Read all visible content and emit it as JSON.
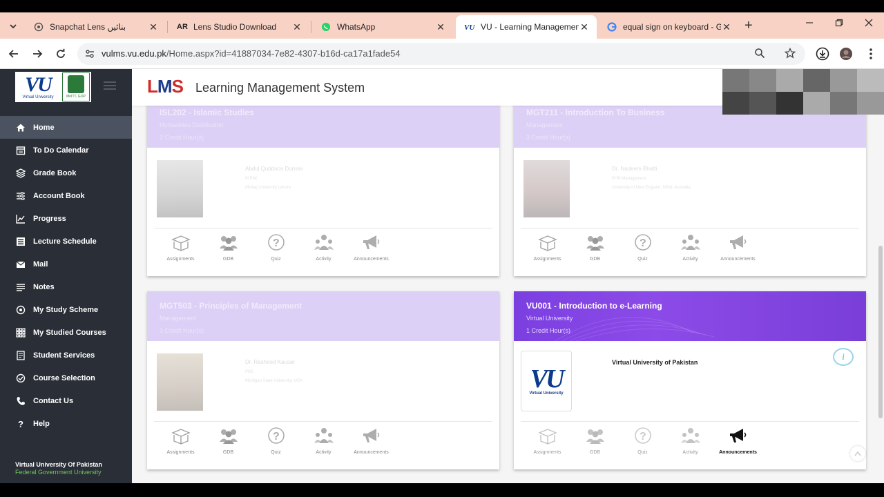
{
  "browser": {
    "tabs": [
      {
        "title": "Snapchat Lens بنائیں",
        "fav": "snap-icon"
      },
      {
        "title": "Lens Studio Download",
        "fav": "AR"
      },
      {
        "title": "WhatsApp",
        "fav": "whatsapp-icon"
      },
      {
        "title": "VU - Learning Management",
        "fav": "vu-icon",
        "active": true
      },
      {
        "title": "equal sign on keyboard - Go",
        "fav": "google-icon"
      }
    ],
    "url_host": "vulms.vu.edu.pk",
    "url_path": "/Home.aspx?id=41887034-7e82-4307-b16d-ca17a1fade54",
    "close_glyph": "✕",
    "new_tab_glyph": "+"
  },
  "sidebar": {
    "logo_text": "VU",
    "logo_sub": "Virtual University",
    "seal_cap": "MoITT, GOP",
    "items": [
      {
        "label": "Home",
        "icon": "home-icon"
      },
      {
        "label": "To Do Calendar",
        "icon": "calendar-icon"
      },
      {
        "label": "Grade Book",
        "icon": "grade-icon"
      },
      {
        "label": "Account Book",
        "icon": "account-icon"
      },
      {
        "label": "Progress",
        "icon": "progress-icon"
      },
      {
        "label": "Lecture Schedule",
        "icon": "schedule-icon"
      },
      {
        "label": "Mail",
        "icon": "mail-icon"
      },
      {
        "label": "Notes",
        "icon": "notes-icon"
      },
      {
        "label": "My Study Scheme",
        "icon": "scheme-icon"
      },
      {
        "label": "My Studied Courses",
        "icon": "courses-icon"
      },
      {
        "label": "Student Services",
        "icon": "services-icon"
      },
      {
        "label": "Course Selection",
        "icon": "selection-icon"
      },
      {
        "label": "Contact Us",
        "icon": "phone-icon"
      },
      {
        "label": "Help",
        "icon": "help-icon"
      }
    ],
    "footer_line1": "Virtual University Of Pakistan",
    "footer_line2": "Federal Government University"
  },
  "header": {
    "logo_l": "L",
    "logo_m": "M",
    "logo_s": "S",
    "title": "Learning Management System"
  },
  "actions": [
    "Assignments",
    "GDB",
    "Quiz",
    "Activity",
    "Announcements"
  ],
  "courses": [
    {
      "code": "ISL202 - Islamic Studies",
      "dept": "Humanities Distribution",
      "credits": "2 Credit Hour(s)",
      "instructor": "Abdul Quddoos Durrani",
      "qual": "M.Phil",
      "inst": "Minhaj University Lahore"
    },
    {
      "code": "MGT211 - Introduction To Business",
      "dept": "Management",
      "credits": "3 Credit Hour(s)",
      "instructor": "Dr. Nadeem Bhatti",
      "qual": "PHD Management",
      "inst": "University of New England, NSW, Australia"
    },
    {
      "code": "MGT503 - Principles of Management",
      "dept": "Management",
      "credits": "3 Credit Hour(s)",
      "instructor": "Dr. Rasheed Kausar",
      "qual": "PhD",
      "inst": "Michigan State University, USA"
    },
    {
      "code": "VU001 - Introduction to e-Learning",
      "dept": "Virtual University",
      "credits": "1 Credit Hour(s)",
      "instructor": "Virtual University of Pakistan",
      "info_glyph": "i",
      "logo_text": "VU",
      "logo_sub": "Virtual University"
    }
  ],
  "colors": {
    "sidebar": "#2a2f37",
    "card_head": "#ddd0f6",
    "active_head": "#7b3fe0",
    "accent_green": "#6fc35b"
  }
}
